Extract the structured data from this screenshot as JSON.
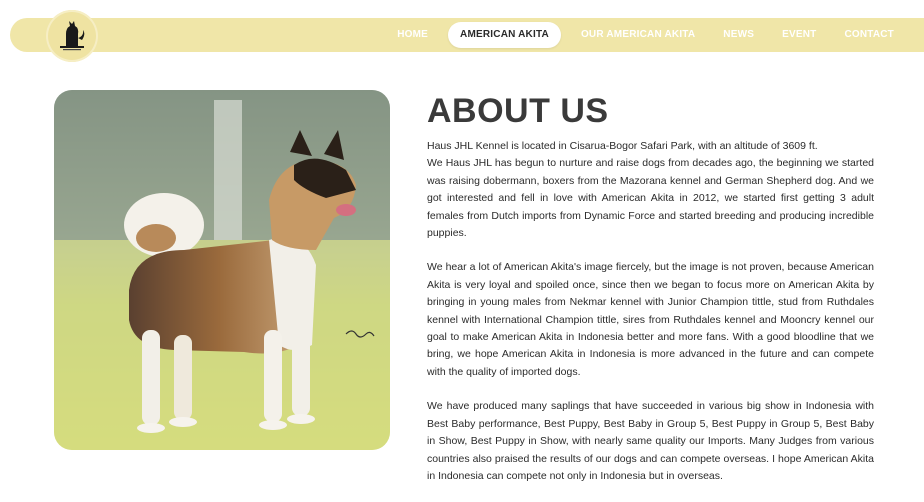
{
  "nav": {
    "items": [
      {
        "label": "HOME",
        "active": false
      },
      {
        "label": "AMERICAN AKITA",
        "active": true
      },
      {
        "label": "OUR AMERICAN AKITA",
        "active": false
      },
      {
        "label": "NEWS",
        "active": false
      },
      {
        "label": "EVENT",
        "active": false
      },
      {
        "label": "CONTACT",
        "active": false
      }
    ],
    "logo_icon": "dog-logo-icon",
    "bar_color": "#f0e6a8"
  },
  "about": {
    "title": "ABOUT US",
    "p1_line1": "Haus JHL Kennel is located in Cisarua-Bogor Safari Park, with an altitude of 3609 ft.",
    "p1_line2": "We Haus JHL has begun to nurture and raise dogs from decades ago, the beginning we started was raising dobermann, boxers from the Mazorana kennel and German Shepherd dog. And we got interested and fell in love with American Akita in 2012, we started first getting 3 adult females from Dutch imports from Dynamic Force and started breeding and producing incredible puppies.",
    "p2": "We hear a lot of American Akita's image fiercely, but the image is not proven, because American Akita is very loyal and spoiled once, since then we began to focus more on American Akita by bringing in young males from Nekmar kennel with Junior Champion tittle, stud from Ruthdales kennel with International Champion tittle, sires from Ruthdales kennel and Mooncry kennel our goal to make American Akita in Indonesia better and more fans. With a good bloodline that we bring, we hope American Akita in Indonesia is more advanced in the future and can compete with the quality of imported dogs.",
    "p3": "We have produced many saplings that have succeeded in various big show in Indonesia with Best Baby performance, Best Puppy, Best Baby in Group 5, Best Puppy in Group 5, Best Baby in Show, Best Puppy in Show, with nearly same quality our Imports. Many Judges from various countries also praised the results of our dogs and can compete overseas. I hope American Akita in Indonesia can compete not only in Indonesia but in overseas."
  }
}
